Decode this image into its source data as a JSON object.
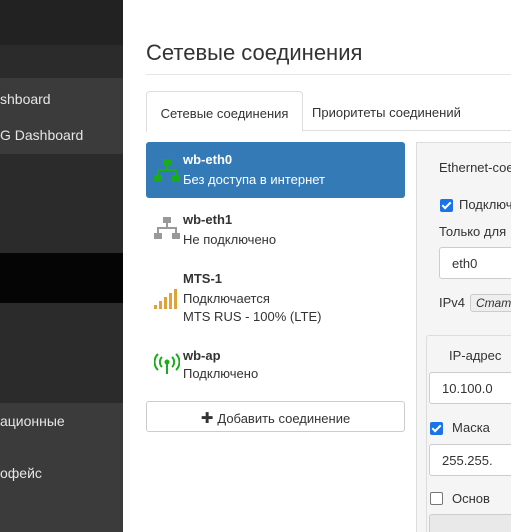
{
  "sidebar": {
    "dashboard_items": [
      "shboard",
      "G Dashboard"
    ],
    "lower_items": [
      "ационные",
      "офейс"
    ]
  },
  "main": {
    "title": "Сетевые соединения",
    "tabs": [
      {
        "label": "Сетевые соединения",
        "active": true
      },
      {
        "label": "Приоритеты соединений",
        "active": false
      }
    ],
    "connections": [
      {
        "name": "wb-eth0",
        "status": "Без доступа в интернет",
        "icon": "ethernet-icon",
        "active": true
      },
      {
        "name": "wb-eth1",
        "status": "Не подключено",
        "icon": "ethernet-icon",
        "active": false
      },
      {
        "name": "MTS-1",
        "status": "Подключается",
        "detail": "MTS RUS - 100% (LTE)",
        "icon": "signal-bars-icon",
        "active": false
      },
      {
        "name": "wb-ap",
        "status": "Подключено",
        "icon": "wifi-ap-icon",
        "active": false
      }
    ],
    "add_button": {
      "label": "Добавить соединение",
      "icon": "plus-icon"
    }
  },
  "panel": {
    "heading": "Ethernet-сое",
    "connect_checkbox": {
      "label": "Подключ",
      "checked": true
    },
    "only_for_label": "Только для",
    "interface_value": "eth0",
    "ipv4_label": "IPv4",
    "ipv4_method": "Стат",
    "ip_label": "IP-адрес",
    "ip_value": "10.100.0",
    "mask_checkbox": {
      "label": "Маска",
      "checked": true
    },
    "mask_value": "255.255.",
    "gateway_checkbox": {
      "label": "Основ",
      "checked": false
    }
  },
  "colors": {
    "active_bg": "#337ab7",
    "sidebar_bg": "#2b2b2b",
    "status_green": "#1aad19",
    "signal_orange": "#e2a23b"
  }
}
